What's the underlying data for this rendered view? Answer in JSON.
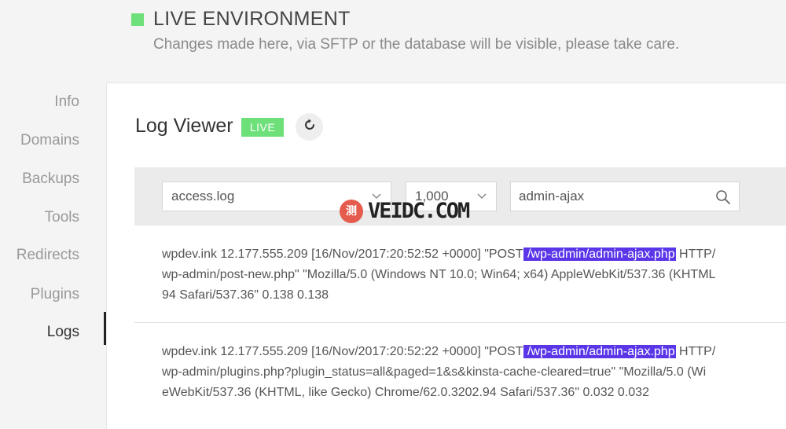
{
  "environment": {
    "title": "LIVE ENVIRONMENT",
    "subtitle": "Changes made here, via SFTP or the database will be visible, please take care.",
    "indicator_color": "#6ee07a"
  },
  "sidebar": {
    "items": [
      {
        "label": "Info"
      },
      {
        "label": "Domains"
      },
      {
        "label": "Backups"
      },
      {
        "label": "Tools"
      },
      {
        "label": "Redirects"
      },
      {
        "label": "Plugins"
      },
      {
        "label": "Logs",
        "active": true
      }
    ]
  },
  "log_viewer": {
    "title": "Log Viewer",
    "badge": "LIVE",
    "refresh_icon": "refresh-icon",
    "file_select": {
      "value": "access.log"
    },
    "lines_select": {
      "value": "1,000"
    },
    "search": {
      "value": "admin-ajax",
      "icon": "search-icon"
    },
    "highlight_color": "#5a36e8",
    "entries": [
      {
        "line1_prefix": "wpdev.ink 12.177.555.209 [16/Nov/2017:20:52:52 +0000] \"POST",
        "line1_match": " /wp-admin/admin-ajax.php",
        "line1_suffix": " HTTP/",
        "line2": "wp-admin/post-new.php\" \"Mozilla/5.0 (Windows NT 10.0; Win64; x64) AppleWebKit/537.36 (KHTML",
        "line3": "94 Safari/537.36\" 0.138 0.138"
      },
      {
        "line1_prefix": "wpdev.ink 12.177.555.209 [16/Nov/2017:20:52:22 +0000] \"POST",
        "line1_match": " /wp-admin/admin-ajax.php",
        "line1_suffix": " HTTP/",
        "line2": "wp-admin/plugins.php?plugin_status=all&paged=1&s&kinsta-cache-cleared=true\" \"Mozilla/5.0 (Wi",
        "line3": "eWebKit/537.36 (KHTML, like Gecko) Chrome/62.0.3202.94 Safari/537.36\" 0.032 0.032"
      }
    ]
  },
  "watermark": {
    "glyph": "测",
    "text": "VEIDC.COM"
  }
}
